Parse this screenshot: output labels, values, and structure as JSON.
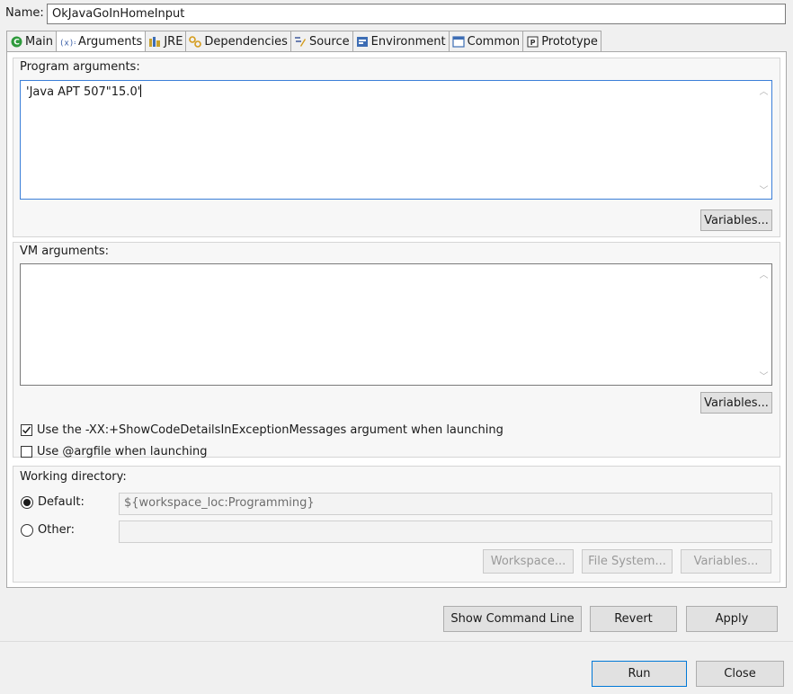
{
  "name": {
    "label": "Name:",
    "value": "OkJavaGoInHomeInput"
  },
  "tabs": [
    {
      "label": "Main",
      "icon": "main-icon"
    },
    {
      "label": "Arguments",
      "icon": "arguments-icon"
    },
    {
      "label": "JRE",
      "icon": "jre-icon"
    },
    {
      "label": "Dependencies",
      "icon": "dependencies-icon"
    },
    {
      "label": "Source",
      "icon": "source-icon"
    },
    {
      "label": "Environment",
      "icon": "environment-icon"
    },
    {
      "label": "Common",
      "icon": "common-icon"
    },
    {
      "label": "Prototype",
      "icon": "prototype-icon"
    }
  ],
  "active_tab": "Arguments",
  "program_args": {
    "label": "Program arguments:",
    "value": "'Java APT 507\"15.0'",
    "variables_label": "Variables..."
  },
  "vm_args": {
    "label": "VM arguments:",
    "value": "",
    "variables_label": "Variables..."
  },
  "options": {
    "show_code_details": {
      "label": "Use the -XX:+ShowCodeDetailsInExceptionMessages argument when launching",
      "checked": true
    },
    "argfile": {
      "label": "Use @argfile when launching",
      "checked": false
    }
  },
  "working_dir": {
    "label": "Working directory:",
    "default_label": "Default:",
    "default_value": "${workspace_loc:Programming}",
    "other_label": "Other:",
    "other_value": "",
    "selected": "default",
    "workspace_btn": "Workspace...",
    "filesystem_btn": "File System...",
    "variables_btn": "Variables..."
  },
  "actions": {
    "show_command_line": "Show Command Line",
    "revert": "Revert",
    "apply": "Apply",
    "run": "Run",
    "close": "Close"
  },
  "colors": {
    "focus_border": "#3c7fd8",
    "primary_border": "#0078d7",
    "main_icon": "#2e9a3c"
  }
}
